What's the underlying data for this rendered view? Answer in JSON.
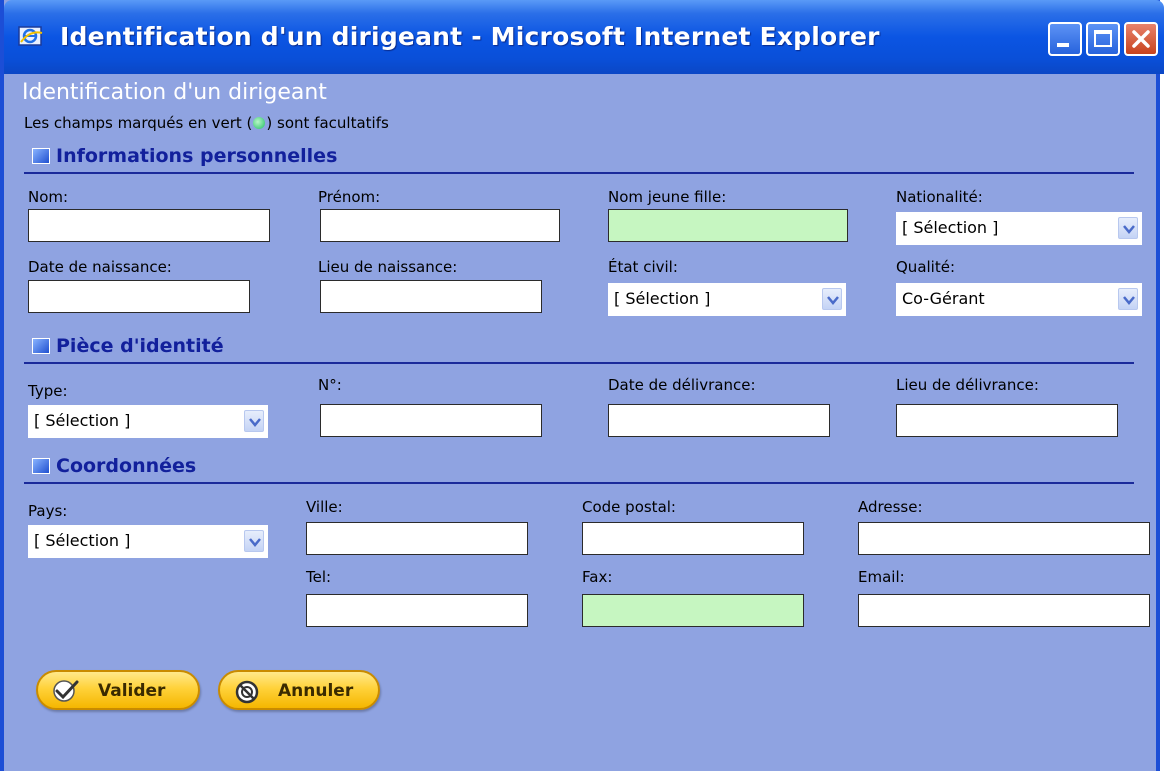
{
  "window": {
    "title": "Identification d'un dirigeant - Microsoft Internet Explorer",
    "controls": {
      "minimize": "minimize",
      "maximize": "maximize",
      "close": "close"
    }
  },
  "page": {
    "heading": "Identification d'un dirigeant",
    "legend_before": "Les champs marqués en vert (",
    "legend_after": ") sont facultatifs"
  },
  "sections": {
    "personal": {
      "title": "Informations personnelles",
      "nom_label": "Nom:",
      "prenom_label": "Prénom:",
      "nom_jeune_fille_label": "Nom jeune fille:",
      "nationalite_label": "Nationalité:",
      "nationalite_value": "[ Sélection ]",
      "date_naissance_label": "Date de naissance:",
      "lieu_naissance_label": "Lieu de naissance:",
      "etat_civil_label": "État civil:",
      "etat_civil_value": "[ Sélection ]",
      "qualite_label": "Qualité:",
      "qualite_value": "Co-Gérant"
    },
    "identity": {
      "title": "Pièce d'identité",
      "type_label": "Type:",
      "type_value": "[ Sélection ]",
      "numero_label": "N°:",
      "date_delivrance_label": "Date de délivrance:",
      "lieu_delivrance_label": "Lieu de délivrance:"
    },
    "contact": {
      "title": "Coordonnées",
      "pays_label": "Pays:",
      "pays_value": "[ Sélection ]",
      "ville_label": "Ville:",
      "code_postal_label": "Code postal:",
      "adresse_label": "Adresse:",
      "tel_label": "Tel:",
      "fax_label": "Fax:",
      "email_label": "Email:"
    }
  },
  "buttons": {
    "valider": "Valider",
    "annuler": "Annuler"
  },
  "colors": {
    "background": "#8fa3e1",
    "optional_field": "#c6f6c1",
    "section_title": "#12209c",
    "titlebar": "#0b55e3",
    "button": "#ffd23a"
  }
}
